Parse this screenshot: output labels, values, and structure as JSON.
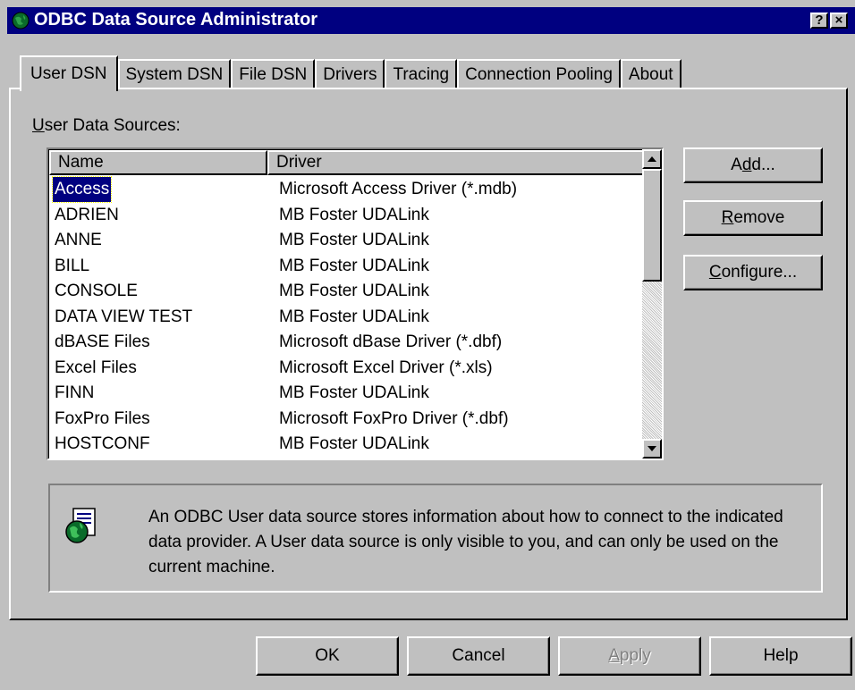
{
  "window": {
    "title": "ODBC Data Source Administrator",
    "help_glyph": "?",
    "close_glyph": "×"
  },
  "tabs": [
    {
      "label": "User DSN",
      "active": true
    },
    {
      "label": "System DSN"
    },
    {
      "label": "File DSN"
    },
    {
      "label": "Drivers"
    },
    {
      "label": "Tracing"
    },
    {
      "label": "Connection Pooling"
    },
    {
      "label": "About"
    }
  ],
  "section": {
    "label_first": "U",
    "label_rest": "ser Data Sources:"
  },
  "list": {
    "columns": [
      "Name",
      "Driver"
    ],
    "rows": [
      {
        "name": "Access",
        "driver": "Microsoft Access Driver (*.mdb)",
        "selected": true
      },
      {
        "name": "ADRIEN",
        "driver": "MB Foster UDALink"
      },
      {
        "name": "ANNE",
        "driver": "MB Foster UDALink"
      },
      {
        "name": "BILL",
        "driver": "MB Foster UDALink"
      },
      {
        "name": "CONSOLE",
        "driver": "MB Foster UDALink"
      },
      {
        "name": "DATA VIEW TEST",
        "driver": "MB Foster UDALink"
      },
      {
        "name": "dBASE Files",
        "driver": "Microsoft dBase Driver (*.dbf)"
      },
      {
        "name": "Excel Files",
        "driver": "Microsoft Excel Driver (*.xls)"
      },
      {
        "name": "FINN",
        "driver": "MB Foster UDALink"
      },
      {
        "name": "FoxPro Files",
        "driver": "Microsoft FoxPro Driver (*.dbf)"
      },
      {
        "name": "HOSTCONF",
        "driver": "MB Foster UDALink"
      }
    ]
  },
  "buttons": {
    "add": {
      "pre": "A",
      "mnemonic": "d",
      "post": "d..."
    },
    "remove": {
      "pre": "",
      "mnemonic": "R",
      "post": "emove"
    },
    "configure": {
      "pre": "",
      "mnemonic": "C",
      "post": "onfigure..."
    },
    "ok": "OK",
    "cancel": "Cancel",
    "apply": {
      "pre": "",
      "mnemonic": "A",
      "post": "pply",
      "disabled": true
    },
    "help": "Help"
  },
  "info": {
    "text": "An ODBC User data source stores information about how to connect to the indicated data provider.   A User data source is only visible to you, and can only be used on the current machine."
  },
  "colors": {
    "titlebar": "#000080",
    "face": "#c0c0c0",
    "selection": "#000080"
  }
}
